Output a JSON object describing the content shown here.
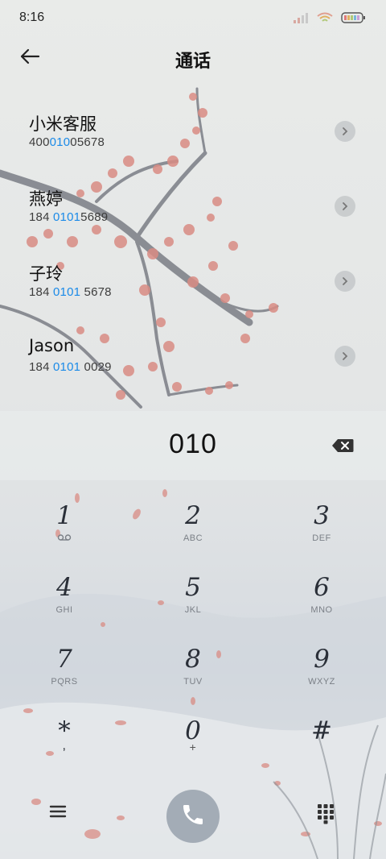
{
  "status": {
    "time": "8:16",
    "icons": [
      "signal-icon",
      "wifi-icon",
      "battery-icon"
    ]
  },
  "header": {
    "title": "通话",
    "back_icon": "arrow-left-icon"
  },
  "results": [
    {
      "name": "小米客服",
      "number_pre": "400",
      "number_hl": "010",
      "number_post": "05678"
    },
    {
      "name": "燕婷",
      "number_pre": "184 ",
      "number_hl": "0101",
      "number_post": "5689"
    },
    {
      "name": "子玲",
      "number_pre": "184 ",
      "number_hl": "0101",
      "number_post": " 5678"
    },
    {
      "name": "Jason",
      "number_pre": "184 ",
      "number_hl": "0101",
      "number_post": " 0029"
    }
  ],
  "dial": {
    "value": "010",
    "backspace_icon": "backspace-icon"
  },
  "keypad": [
    {
      "digit": "1",
      "sub": ""
    },
    {
      "digit": "2",
      "sub": "ABC"
    },
    {
      "digit": "3",
      "sub": "DEF"
    },
    {
      "digit": "4",
      "sub": "GHI"
    },
    {
      "digit": "5",
      "sub": "JKL"
    },
    {
      "digit": "6",
      "sub": "MNO"
    },
    {
      "digit": "7",
      "sub": "PQRS"
    },
    {
      "digit": "8",
      "sub": "TUV"
    },
    {
      "digit": "9",
      "sub": "WXYZ"
    },
    {
      "digit": "*",
      "sub": ","
    },
    {
      "digit": "0",
      "sub": "+"
    },
    {
      "digit": "#",
      "sub": ""
    }
  ],
  "bottom": {
    "menu_icon": "menu-icon",
    "call_icon": "phone-icon",
    "keypad_icon": "dialpad-icon"
  },
  "colors": {
    "highlight": "#1a8ae8",
    "call_button": "#a3acb6",
    "blossom": "#d98c84"
  }
}
